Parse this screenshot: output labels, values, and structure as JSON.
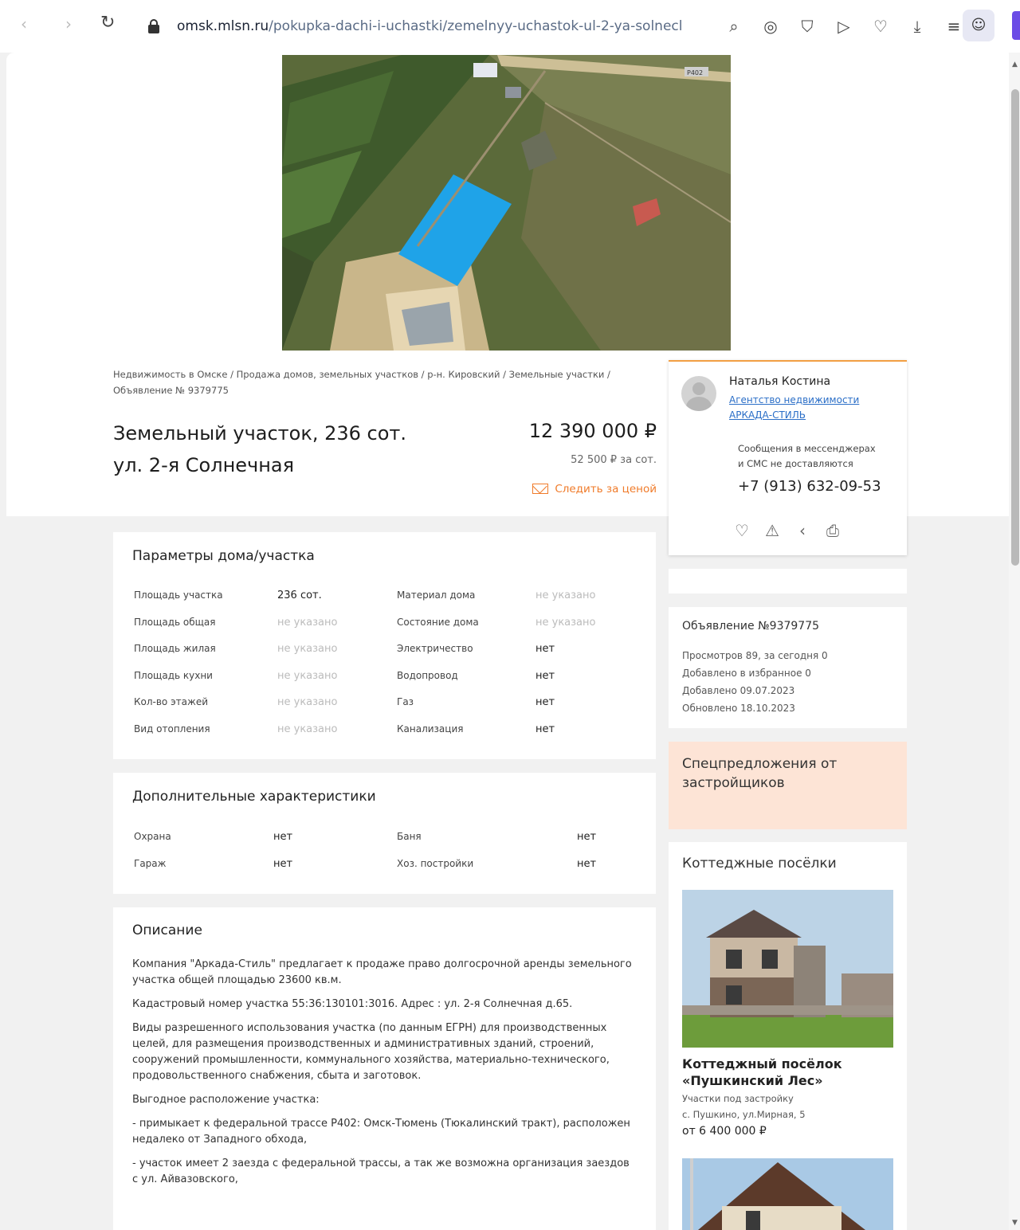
{
  "browser": {
    "url_host": "omsk.mlsn.ru",
    "url_path": "/pokupka-dachi-i-uchastki/zemelnyy-uchastok-ul-2-ya-solnecl"
  },
  "breadcrumb": "Недвижимость в Омске / Продажа домов, земельных участков / р-н. Кировский / Земельные участки / Объявление № 9379775",
  "listing": {
    "title_line1": "Земельный участок, 236 сот.",
    "title_line2": "ул. 2-я Солнечная",
    "price": "12 390 000 ₽",
    "price_per": "52 500 ₽ за сот.",
    "watch_price": "Следить за ценой"
  },
  "agent": {
    "name": "Наталья Костина",
    "agency_line1": "Агентство недвижимости",
    "agency_line2": "АРКАДА-СТИЛЬ",
    "note_line1": "Сообщения в мессенджерах",
    "note_line2": "и СМС не доставляются",
    "phone": "+7 (913) 632-09-53"
  },
  "params": {
    "title": "Параметры дома/участка",
    "rows": [
      {
        "l1": "Площадь участка",
        "v1": "236 сот.",
        "l2": "Материал дома",
        "v2": "не указано"
      },
      {
        "l1": "Площадь общая",
        "v1": "не указано",
        "l2": "Состояние дома",
        "v2": "не указано"
      },
      {
        "l1": "Площадь жилая",
        "v1": "не указано",
        "l2": "Электричество",
        "v2": "нет"
      },
      {
        "l1": "Площадь кухни",
        "v1": "не указано",
        "l2": "Водопровод",
        "v2": "нет"
      },
      {
        "l1": "Кол-во этажей",
        "v1": "не указано",
        "l2": "Газ",
        "v2": "нет"
      },
      {
        "l1": "Вид отопления",
        "v1": "не указано",
        "l2": "Канализация",
        "v2": "нет"
      }
    ]
  },
  "extra": {
    "title": "Дополнительные характеристики",
    "rows": [
      {
        "l1": "Охрана",
        "v1": "нет",
        "l2": "Баня",
        "v2": "нет"
      },
      {
        "l1": "Гараж",
        "v1": "нет",
        "l2": "Хоз. постройки",
        "v2": "нет"
      }
    ]
  },
  "description": {
    "title": "Описание",
    "paragraphs": [
      "Компания \"Аркада-Стиль\" предлагает к продаже право долгосрочной аренды земельного участка общей площадью 23600 кв.м.",
      "Кадастровый номер участка 55:36:130101:3016. Адрес : ул. 2-я Солнечная д.65.",
      "Виды разрешенного использования участка (по данным ЕГРН) для производственных целей, для размещения производственных и административных зданий, строений, сооружений промышленности, коммунального хозяйства, материально-технического, продовольственного снабжения, сбыта и заготовок.",
      "Выгодное расположение участка:",
      "- примыкает к федеральной трассе Р402: Омск-Тюмень (Тюкалинский тракт), расположен недалеко от Западного обхода,",
      "- участок имеет 2 заезда с федеральной трассы, а так же возможна организация заездов с ул. Айвазовского,"
    ]
  },
  "stats": {
    "title": "Объявление №9379775",
    "views": "Просмотров 89, за сегодня 0",
    "favorites": "Добавлено в избранное 0",
    "added": "Добавлено 09.07.2023",
    "updated": "Обновлено 18.10.2023"
  },
  "promo": {
    "text": "Спецпредложения от застройщиков"
  },
  "villages": {
    "title": "Коттеджные посёлки",
    "item": {
      "name": "Коттеджный посёлок «Пушкинский Лес»",
      "subtitle": "Участки под застройку",
      "address": "с. Пушкино, ул.Мирная, 5",
      "price": "от 6 400 000 ₽"
    }
  },
  "map_label": "P402",
  "colors": {
    "accent": "#f07b2a",
    "link": "#2a6ec7",
    "plot_highlight": "#1fa3e8",
    "promo_bg": "#fde4d6"
  }
}
